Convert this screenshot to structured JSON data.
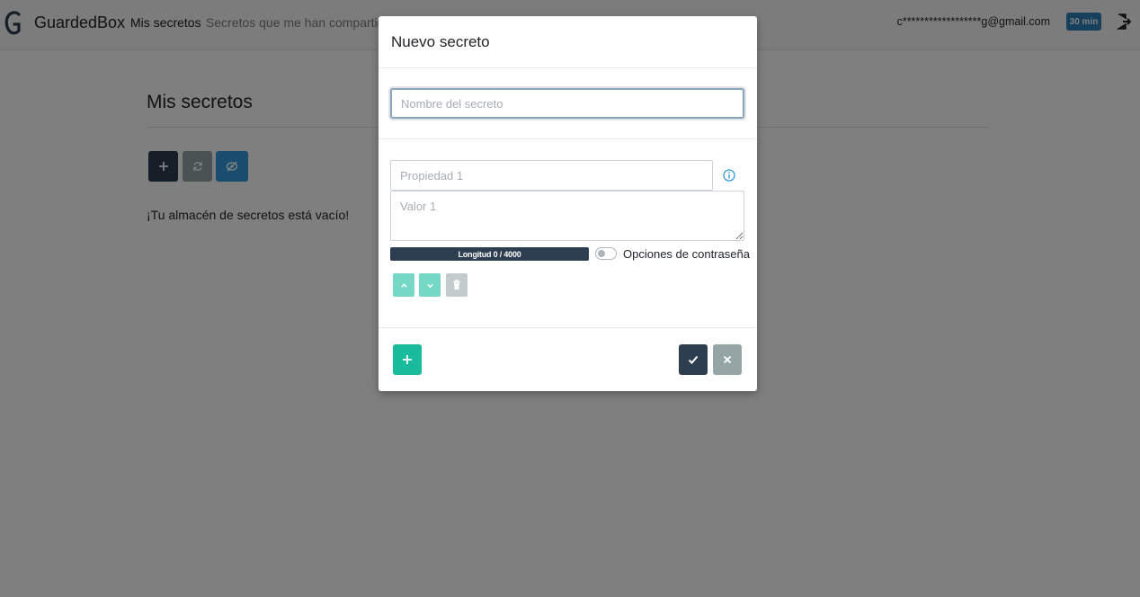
{
  "navbar": {
    "brand": "GuardedBox",
    "links": [
      {
        "label": "Mis secretos",
        "active": true
      },
      {
        "label": "Secretos que me han compartido",
        "active": false
      }
    ],
    "user_email": "c******************g@gmail.com",
    "session_badge": "30 min"
  },
  "page": {
    "title": "Mis secretos",
    "empty_message": "¡Tu almacén de secretos está vacío!",
    "toolbar": [
      {
        "icon": "plus-icon",
        "color": "#2c3e50"
      },
      {
        "icon": "refresh-icon",
        "color": "#95a5a6"
      },
      {
        "icon": "eye-slash-icon",
        "color": "#3498db"
      }
    ]
  },
  "modal": {
    "title": "Nuevo secreto",
    "name_placeholder": "Nombre del secreto",
    "property_placeholder": "Propiedad 1",
    "value_placeholder": "Valor 1",
    "length_label": "Longitud 0 / 4000",
    "password_options_label": "Opciones de contraseña",
    "password_options_enabled": false,
    "colors": {
      "primary": "#2c3e50",
      "success": "#18bc9c",
      "secondary": "#95a5a6",
      "info": "#3498db"
    }
  }
}
